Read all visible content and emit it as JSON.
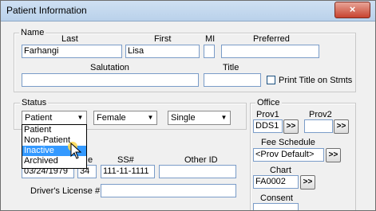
{
  "window": {
    "title": "Patient Information",
    "close_glyph": "×"
  },
  "name_group": {
    "label": "Name",
    "last_label": "Last",
    "last_value": "Farhangi",
    "first_label": "First",
    "first_value": "Lisa",
    "mi_label": "MI",
    "mi_value": "",
    "preferred_label": "Preferred",
    "preferred_value": "",
    "salutation_label": "Salutation",
    "salutation_value": "",
    "title_label": "Title",
    "title_value": "",
    "print_title_label": "Print Title on Stmts"
  },
  "status_group": {
    "label": "Status",
    "status_value": "Patient",
    "gender_value": "Female",
    "marital_value": "Single",
    "status_options": [
      "Patient",
      "Non-Patient",
      "Inactive",
      "Archived"
    ],
    "selected_option": "Inactive"
  },
  "details": {
    "birth_partial_label": "e",
    "ssn_label": "SS#",
    "other_id_label": "Other ID",
    "birth_value": "03/24/1979",
    "age_value": "34",
    "ssn_value": "111-11-1111",
    "other_id_value": "",
    "drivers_license_label": "Driver's License #",
    "drivers_license_value": ""
  },
  "office_group": {
    "label": "Office",
    "prov1_label": "Prov1",
    "prov1_value": "DDS1",
    "prov2_label": "Prov2",
    "prov2_value": "",
    "fee_label": "Fee Schedule",
    "fee_value": "<Prov Default>",
    "chart_label": "Chart",
    "chart_value": "FA0002",
    "consent_label": "Consent",
    "more_glyph": ">>"
  },
  "icons": {
    "dropdown_arrow": "▼"
  }
}
